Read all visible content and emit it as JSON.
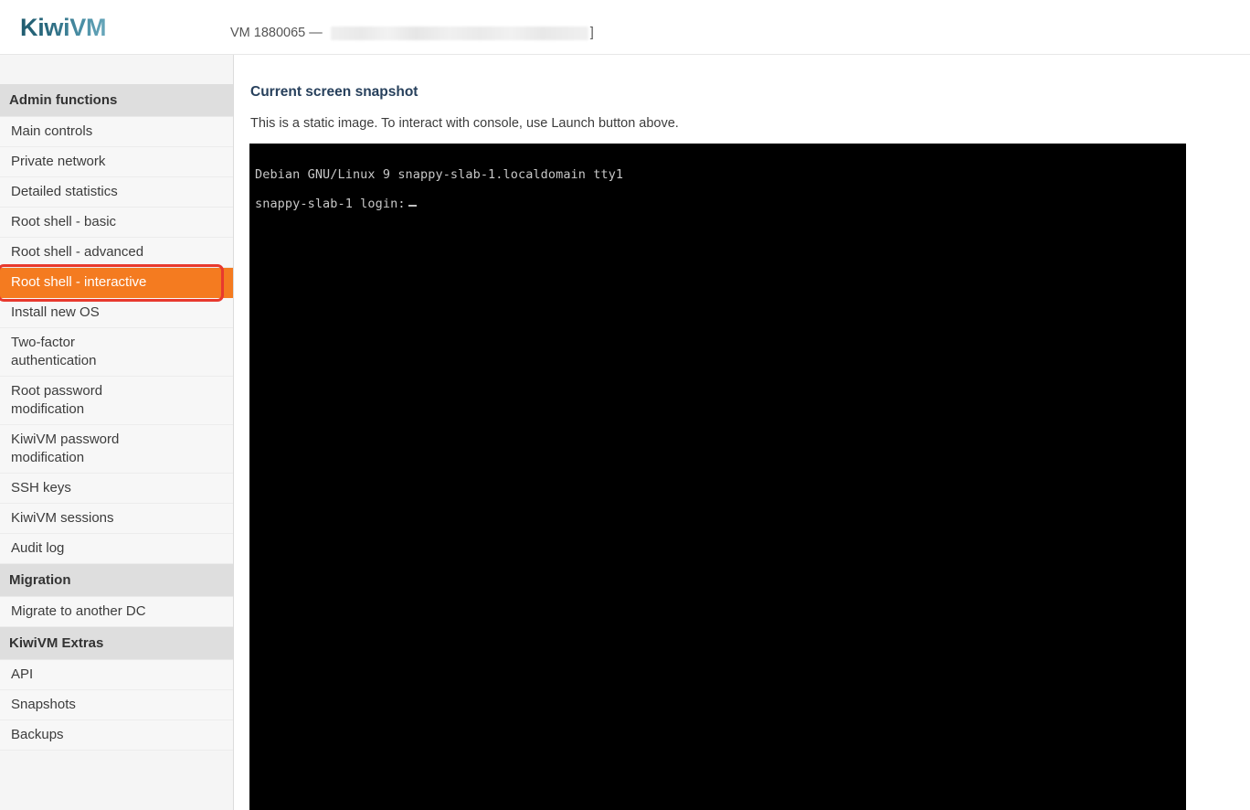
{
  "header": {
    "brand": "KiwiVM",
    "vm_label": "VM 1880065 —",
    "vm_redacted_suffix": "]"
  },
  "sidebar": {
    "sections": [
      {
        "title": "Admin functions",
        "items": [
          {
            "label": "Main controls",
            "active": false
          },
          {
            "label": "Private network",
            "active": false
          },
          {
            "label": "Detailed statistics",
            "active": false
          },
          {
            "label": "Root shell - basic",
            "active": false
          },
          {
            "label": "Root shell - advanced",
            "active": false
          },
          {
            "label": "Root shell - interactive",
            "active": true
          },
          {
            "label": "Install new OS",
            "active": false
          },
          {
            "label": "Two-factor authentication",
            "active": false
          },
          {
            "label": "Root password modification",
            "active": false
          },
          {
            "label": "KiwiVM password modification",
            "active": false
          },
          {
            "label": "SSH keys",
            "active": false
          },
          {
            "label": "KiwiVM sessions",
            "active": false
          },
          {
            "label": "Audit log",
            "active": false
          }
        ]
      },
      {
        "title": "Migration",
        "items": [
          {
            "label": "Migrate to another DC",
            "active": false
          }
        ]
      },
      {
        "title": "KiwiVM Extras",
        "items": [
          {
            "label": "API",
            "active": false
          },
          {
            "label": "Snapshots",
            "active": false
          },
          {
            "label": "Backups",
            "active": false
          }
        ]
      }
    ]
  },
  "main": {
    "title": "Current screen snapshot",
    "note": "This is a static image. To interact with console, use Launch button above.",
    "console": {
      "lines": [
        "Debian GNU/Linux 9 snappy-slab-1.localdomain tty1",
        "snappy-slab-1 login:"
      ],
      "cursor": "_"
    }
  },
  "colors": {
    "brand_teal": "#2c6b80",
    "active_orange": "#f47b20",
    "annotation_red": "#e8392e",
    "heading_navy": "#27405c",
    "sidebar_bg": "#f5f5f5",
    "section_bg": "#dedede",
    "console_bg": "#000000",
    "console_text": "#c8c8c8"
  }
}
